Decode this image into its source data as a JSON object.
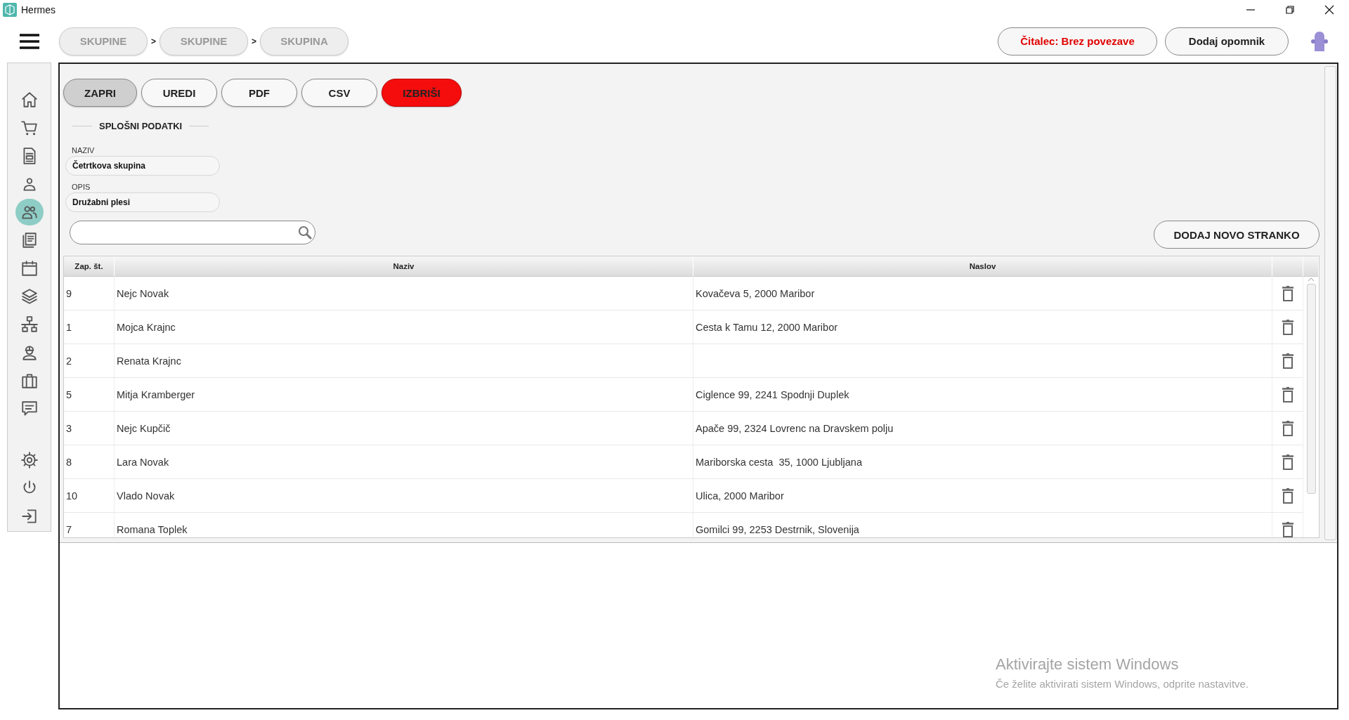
{
  "window": {
    "title": "Hermes"
  },
  "topbar": {
    "breadcrumbs": [
      {
        "label": "SKUPINE"
      },
      {
        "label": "SKUPINE"
      },
      {
        "label": "SKUPINA"
      }
    ],
    "separators": [
      ">",
      ">"
    ],
    "reader_button": "Čitalec: Brez povezave",
    "reminder_button": "Dodaj opomnik"
  },
  "sidebar": {
    "items": [
      {
        "selected": false
      },
      {
        "selected": false
      },
      {
        "selected": false
      },
      {
        "selected": false
      },
      {
        "selected": true
      },
      {
        "selected": false
      },
      {
        "selected": false
      },
      {
        "selected": false
      },
      {
        "selected": false
      },
      {
        "selected": false
      },
      {
        "selected": false
      },
      {
        "selected": false
      },
      {
        "selected": false
      },
      {
        "selected": false
      },
      {
        "selected": false
      }
    ]
  },
  "actions": [
    {
      "label": "ZAPRI",
      "kind": "pressed"
    },
    {
      "label": "UREDI",
      "kind": "default"
    },
    {
      "label": "PDF",
      "kind": "default"
    },
    {
      "label": "CSV",
      "kind": "default"
    },
    {
      "label": "IZBRIŠI",
      "kind": "danger"
    }
  ],
  "section": {
    "title": "SPLOŠNI PODATKI",
    "fields": [
      {
        "label": "NAZIV",
        "value": "Četrtkova skupina"
      },
      {
        "label": "OPIS",
        "value": "Družabni plesi"
      }
    ]
  },
  "add_button": "DODAJ NOVO STRANKO",
  "table": {
    "columns": [
      "Zap. št.",
      "Naziv",
      "Naslov"
    ],
    "rows": [
      {
        "number": "9",
        "name": "Nejc Novak",
        "address": "Kovačeva 5, 2000 Maribor"
      },
      {
        "number": "1",
        "name": "Mojca Krajnc",
        "address": "Cesta k Tamu 12, 2000 Maribor"
      },
      {
        "number": "2",
        "name": "Renata Krajnc"
      },
      {
        "number": "5",
        "name": "Mitja Kramberger",
        "address": "Ciglence 99, 2241 Spodnji Duplek"
      },
      {
        "number": "3",
        "name": "Nejc Kupčič",
        "address": "Apače 99, 2324 Lovrenc na Dravskem polju"
      },
      {
        "number": "8",
        "name": "Lara Novak",
        "address": "Mariborska cesta  35, 1000 Ljubljana"
      },
      {
        "number": "10",
        "name": "Vlado Novak",
        "address": "Ulica, 2000 Maribor"
      },
      {
        "number": "7",
        "name": "Romana Toplek",
        "address": "Gomilci 99, 2253 Destrnik, Slovenija"
      }
    ]
  },
  "activation_notice": {
    "title": "Aktivirajte sistem Windows",
    "text": "Če želite aktivirati sistem Windows, odprite nastavitve."
  }
}
